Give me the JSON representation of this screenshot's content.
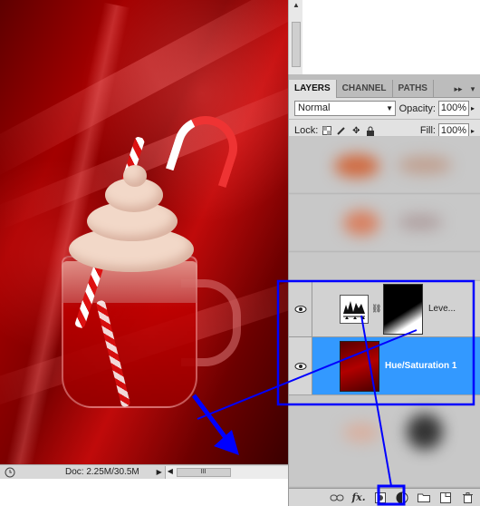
{
  "status_bar": {
    "doc_info": "Doc: 2.25M/30.5M"
  },
  "panel": {
    "tabs": [
      {
        "label": "LAYERS",
        "active": true
      },
      {
        "label": "CHANNEL",
        "active": false
      },
      {
        "label": "PATHS",
        "active": false
      }
    ],
    "blend_mode": "Normal",
    "opacity_label": "Opacity:",
    "opacity_value": "100%",
    "lock_label": "Lock:",
    "fill_label": "Fill:",
    "fill_value": "100%",
    "layers": [
      {
        "name": "Leve...",
        "type": "levels-adjustment",
        "selected": false,
        "visible": true
      },
      {
        "name": "Hue/Saturation 1",
        "type": "image",
        "selected": true,
        "visible": true
      }
    ],
    "bottom_icons": [
      "link-icon",
      "fx-icon",
      "mask-icon",
      "adjustment-icon",
      "folder-icon",
      "new-layer-icon",
      "trash-icon"
    ]
  },
  "colors": {
    "selection": "#3399ff",
    "annotation": "#0000ff",
    "canvas_red": "#a30000"
  }
}
